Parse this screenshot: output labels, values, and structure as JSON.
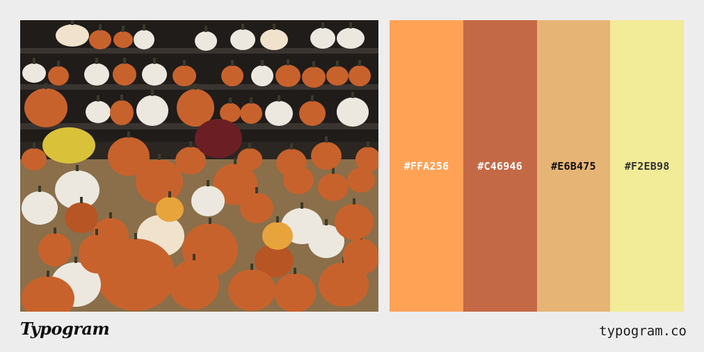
{
  "palette": {
    "swatches": [
      {
        "label": "#FFA256",
        "color": "#FFA256",
        "text_color": "#ffffff"
      },
      {
        "label": "#C46946",
        "color": "#C46946",
        "text_color": "#ffffff"
      },
      {
        "label": "#E6B475",
        "color": "#E6B475",
        "text_color": "#111111"
      },
      {
        "label": "#F2EB98",
        "color": "#F2EB98",
        "text_color": "#333333"
      }
    ]
  },
  "footer": {
    "brand": "Typogram",
    "site": "typogram.co"
  }
}
